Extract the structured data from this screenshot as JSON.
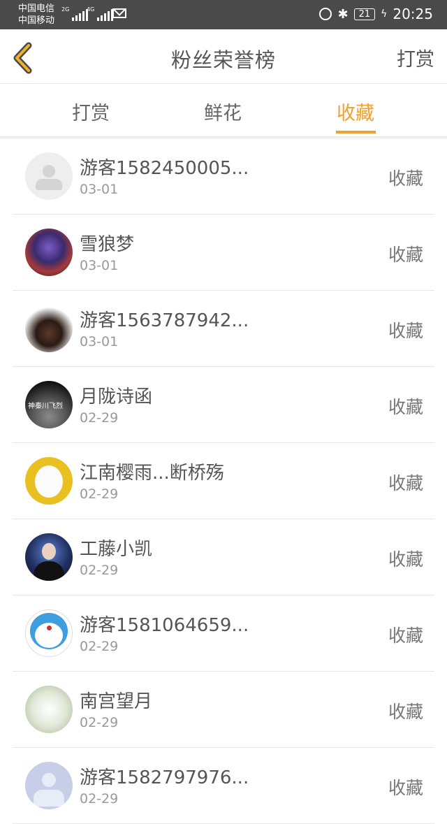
{
  "status_bar": {
    "carrier1": "中国电信",
    "carrier2": "中国移动",
    "net1": "2G",
    "net2": "4G",
    "battery": "21",
    "time": "20:25"
  },
  "header": {
    "title": "粉丝荣誉榜",
    "action": "打赏"
  },
  "tabs": [
    {
      "label": "打赏"
    },
    {
      "label": "鲜花"
    },
    {
      "label": "收藏"
    }
  ],
  "active_tab": "收藏",
  "colors": {
    "accent": "#f0a030"
  },
  "list": [
    {
      "name": "游客1582450005...",
      "date": "03-01",
      "action": "收藏",
      "avatar": "default-avatar"
    },
    {
      "name": "雪狼梦",
      "date": "03-01",
      "action": "收藏",
      "avatar": "anime-avatar"
    },
    {
      "name": "游客1563787942...",
      "date": "03-01",
      "action": "收藏",
      "avatar": "sketch-avatar"
    },
    {
      "name": "月陇诗函",
      "date": "02-29",
      "action": "收藏",
      "avatar": "dark-text-avatar",
      "avatar_text": "神秦川飞烈"
    },
    {
      "name": "江南樱雨...断桥殇",
      "date": "02-29",
      "action": "收藏",
      "avatar": "dog-avatar"
    },
    {
      "name": "工藤小凯",
      "date": "02-29",
      "action": "收藏",
      "avatar": "portrait-avatar"
    },
    {
      "name": "游客1581064659...",
      "date": "02-29",
      "action": "收藏",
      "avatar": "doraemon-avatar"
    },
    {
      "name": "南宫望月",
      "date": "02-29",
      "action": "收藏",
      "avatar": "flower-avatar"
    },
    {
      "name": "游客1582797976...",
      "date": "02-29",
      "action": "收藏",
      "avatar": "default-avatar"
    }
  ]
}
